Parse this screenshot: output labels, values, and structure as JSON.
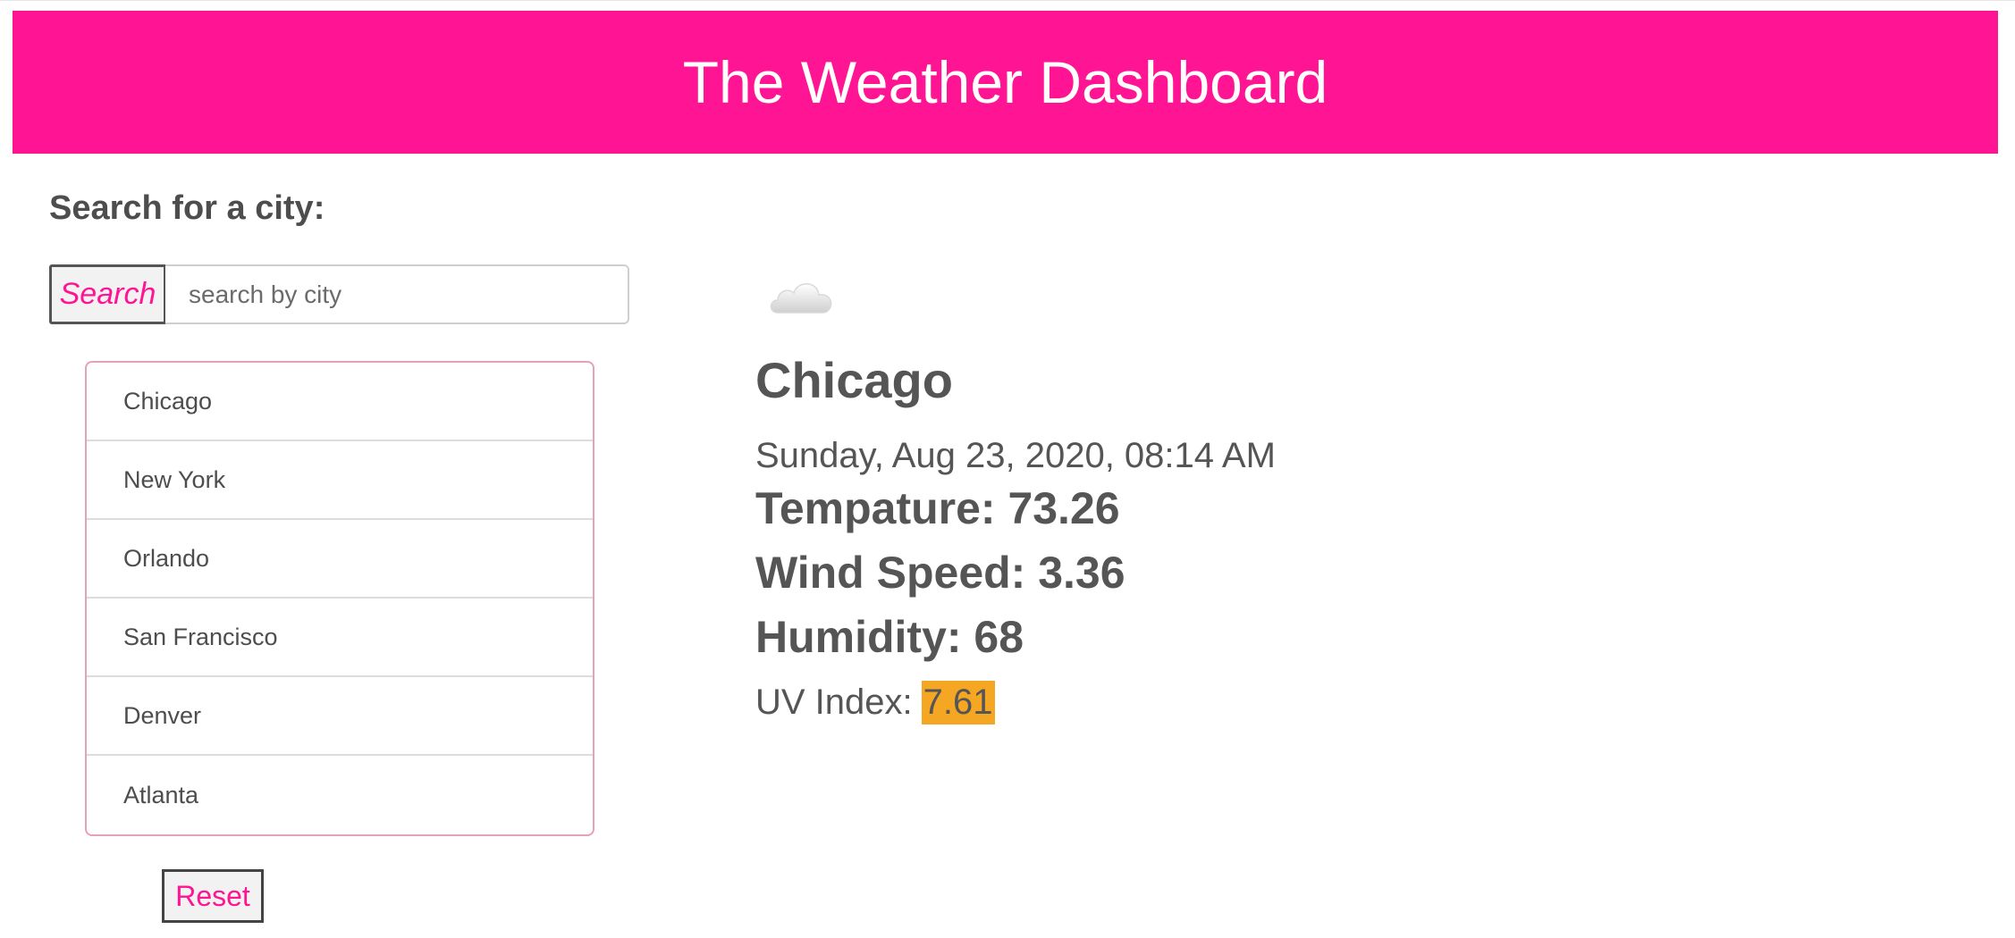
{
  "header": {
    "title": "The Weather Dashboard"
  },
  "sidebar": {
    "heading": "Search for a city:",
    "search": {
      "button_label": "Search",
      "placeholder": "search by city",
      "value": ""
    },
    "cities": [
      "Chicago",
      "New York",
      "Orlando",
      "San Francisco",
      "Denver",
      "Atlanta"
    ],
    "reset_label": "Reset"
  },
  "current": {
    "icon": "cloud-icon",
    "city": "Chicago",
    "datetime": "Sunday, Aug 23, 2020, 08:14 AM",
    "temperature_label": "Tempature: 73.26",
    "wind_label": "Wind Speed: 3.36",
    "humidity_label": "Humidity: 68",
    "uv_label": "UV Index:",
    "uv_value": "7.61",
    "uv_color": "#f5a623"
  },
  "colors": {
    "brand": "#ff1493"
  }
}
